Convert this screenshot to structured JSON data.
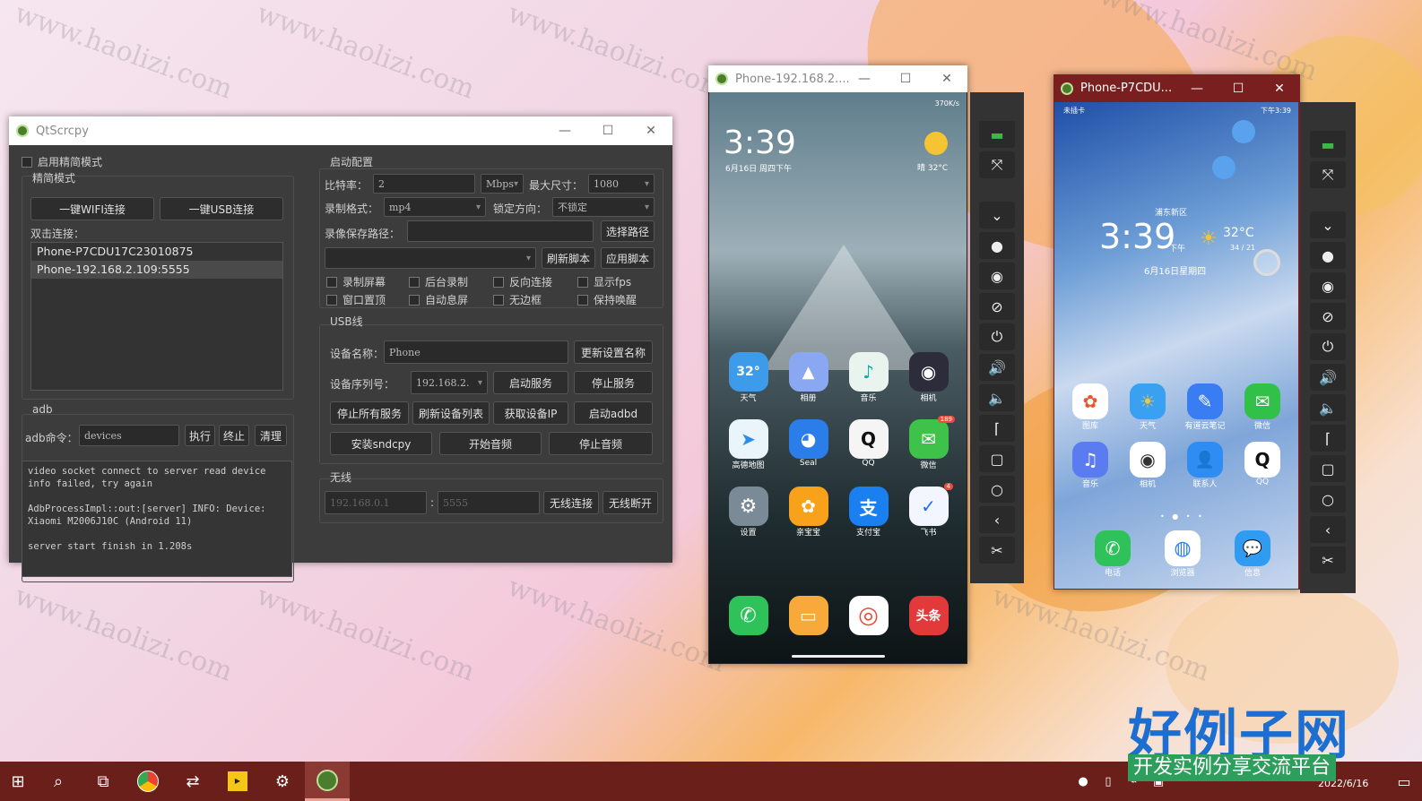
{
  "watermark": "www.haolizi.com",
  "qtscrcpy": {
    "title": "QtScrcpy",
    "simple_mode_checkbox": "启用精简模式",
    "simple_group": "精简模式",
    "wifi_connect": "一键WIFI连接",
    "usb_connect": "一键USB连接",
    "double_click_label": "双击连接：",
    "devices": [
      "Phone-P7CDU17C23010875",
      "Phone-192.168.2.109:5555"
    ],
    "adb_group": "adb",
    "adb_cmd_label": "adb命令：",
    "adb_cmd_value": "devices",
    "btn_exec": "执行",
    "btn_stop": "终止",
    "btn_clear": "清理",
    "log": "video socket connect to server read device info failed, try again\n\nAdbProcessImpl::out:[server] INFO: Device: Xiaomi M2006J10C (Android 11)\n\nserver start finish in 1.208s",
    "start_group": "启动配置",
    "bitrate_label": "比特率：",
    "bitrate_value": "2",
    "bitrate_unit": "Mbps",
    "max_size_label": "最大尺寸：",
    "max_size_value": "1080",
    "record_format_label": "录制格式：",
    "record_format_value": "mp4",
    "lock_orient_label": "锁定方向：",
    "lock_orient_value": "不锁定",
    "record_path_label": "录像保存路径：",
    "select_path": "选择路径",
    "refresh_script": "刷新脚本",
    "apply_script": "应用脚本",
    "checks": [
      "录制屏幕",
      "后台录制",
      "反向连接",
      "显示fps",
      "窗口置顶",
      "自动息屏",
      "无边框",
      "保持唤醒"
    ],
    "usb_group": "USB线",
    "device_name_label": "设备名称：",
    "device_name_value": "Phone",
    "update_name": "更新设置名称",
    "serial_label": "设备序列号：",
    "serial_value": "192.168.2.",
    "start_service": "启动服务",
    "stop_service": "停止服务",
    "stop_all": "停止所有服务",
    "refresh_devices": "刷新设备列表",
    "get_ip": "获取设备IP",
    "start_adbd": "启动adbd",
    "install_sndcpy": "安装sndcpy",
    "start_audio": "开始音频",
    "stop_audio": "停止音频",
    "wireless_group": "无线",
    "ip_placeholder": "192.168.0.1",
    "colon": ":",
    "port_placeholder": "5555",
    "wireless_connect": "无线连接",
    "wireless_disconnect": "无线断开"
  },
  "phone1": {
    "title": "Phone-192.168.2....",
    "status_right": "370K/s",
    "time": "3:39",
    "date": "6月16日 周四下午",
    "weather": "晴 32°C",
    "apps": [
      {
        "label": "天气",
        "glyph": "32°",
        "color": "#3d9be9"
      },
      {
        "label": "相册",
        "glyph": "▲",
        "color": "#8aa7f2"
      },
      {
        "label": "音乐",
        "glyph": "♪",
        "color": "#e9f4ef"
      },
      {
        "label": "相机",
        "glyph": "◉",
        "color": "#2c2c3a"
      },
      {
        "label": "高德地图",
        "glyph": "➤",
        "color": "#e9f4fb"
      },
      {
        "label": "Seal",
        "glyph": "◕",
        "color": "#2b7de9"
      },
      {
        "label": "QQ",
        "glyph": "Q",
        "color": "#f5f5f5"
      },
      {
        "label": "微信",
        "glyph": "✉",
        "color": "#3ec24a"
      },
      {
        "label": "设置",
        "glyph": "⚙",
        "color": "#7a8a97"
      },
      {
        "label": "亲宝宝",
        "glyph": "✿",
        "color": "#f7a21a"
      },
      {
        "label": "支付宝",
        "glyph": "支",
        "color": "#1a7ff0"
      },
      {
        "label": "飞书",
        "glyph": "✓",
        "color": "#f3f6ff"
      }
    ],
    "badge_wechat": "189",
    "badge_feishu": "4",
    "dock": [
      {
        "glyph": "✆",
        "color": "#2fc25b"
      },
      {
        "glyph": "▭",
        "color": "#f7a93a"
      },
      {
        "glyph": "◎",
        "color": "#ffffff"
      },
      {
        "glyph": "头条",
        "color": "#e23a3a"
      }
    ]
  },
  "phone2": {
    "title": "Phone-P7CDU...",
    "status_left": "未插卡",
    "status_right": "下午3:39",
    "location": "浦东新区",
    "time": "3:39",
    "time_suffix": "下午",
    "temp": "32°C",
    "temp_range": "34 / 21",
    "date": "6月16日星期四",
    "apps": [
      {
        "label": "图库",
        "glyph": "✿",
        "color": "#ffffff"
      },
      {
        "label": "天气",
        "glyph": "☀",
        "color": "#3aa0f2"
      },
      {
        "label": "有道云笔记",
        "glyph": "✎",
        "color": "#3a7cf2"
      },
      {
        "label": "微信",
        "glyph": "✉",
        "color": "#31c048"
      },
      {
        "label": "音乐",
        "glyph": "♫",
        "color": "#5a7cf0"
      },
      {
        "label": "相机",
        "glyph": "◉",
        "color": "#ffffff"
      },
      {
        "label": "联系人",
        "glyph": "👤",
        "color": "#2f8cf2"
      },
      {
        "label": "QQ",
        "glyph": "Q",
        "color": "#ffffff"
      }
    ],
    "dock": [
      {
        "label": "电话",
        "glyph": "✆",
        "color": "#2fc25b"
      },
      {
        "label": "浏览器",
        "glyph": "◍",
        "color": "#ffffff"
      },
      {
        "label": "信息",
        "glyph": "💬",
        "color": "#2f9cf2"
      }
    ]
  },
  "brand": {
    "big": "好例子网",
    "small": "开发实例分享交流平台",
    "date": "2022/6/16"
  },
  "colors": {
    "taskbar": "#6b1f1a",
    "qt_bg": "#3c3c3c",
    "brand_blue": "#1c6fd1",
    "brand_green": "#2d9e5b"
  }
}
